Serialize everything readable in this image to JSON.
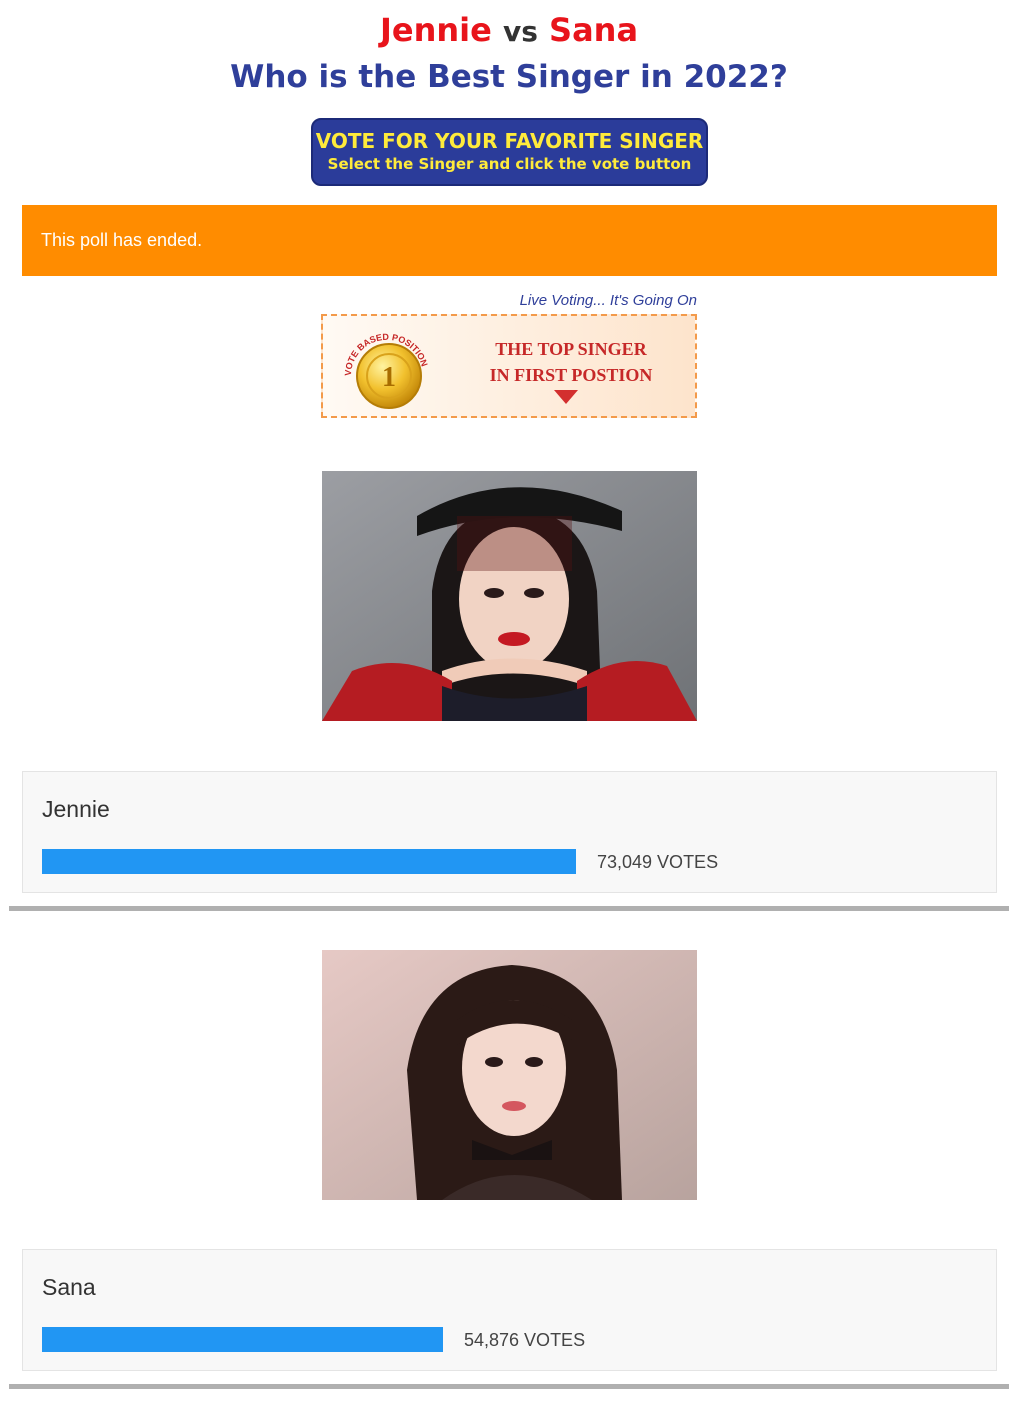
{
  "header": {
    "name1": "Jennie",
    "vs": "vs",
    "name2": "Sana",
    "subtitle": "Who is the Best Singer in 2022?"
  },
  "vote_banner": {
    "line1": "VOTE FOR YOUR FAVORITE SINGER",
    "line2": "Select the Singer and click the vote button"
  },
  "notice": {
    "text": "This poll has ended."
  },
  "top_banner": {
    "live": "Live Voting... It's Going On",
    "medal_arc": "VOTE BASED POSITION",
    "medal_number": "1",
    "line1": "THE TOP SINGER",
    "line2": "IN FIRST POSTION"
  },
  "results": [
    {
      "name": "Jennie",
      "votes": "73,049 VOTES",
      "bar_fraction": 0.571
    },
    {
      "name": "Sana",
      "votes": "54,876 VOTES",
      "bar_fraction": 0.429
    }
  ],
  "colors": {
    "accent_red": "#e8141b",
    "title_blue": "#2f3f9a",
    "notice_orange": "#ff8c00",
    "bar_blue": "#2196f3"
  }
}
